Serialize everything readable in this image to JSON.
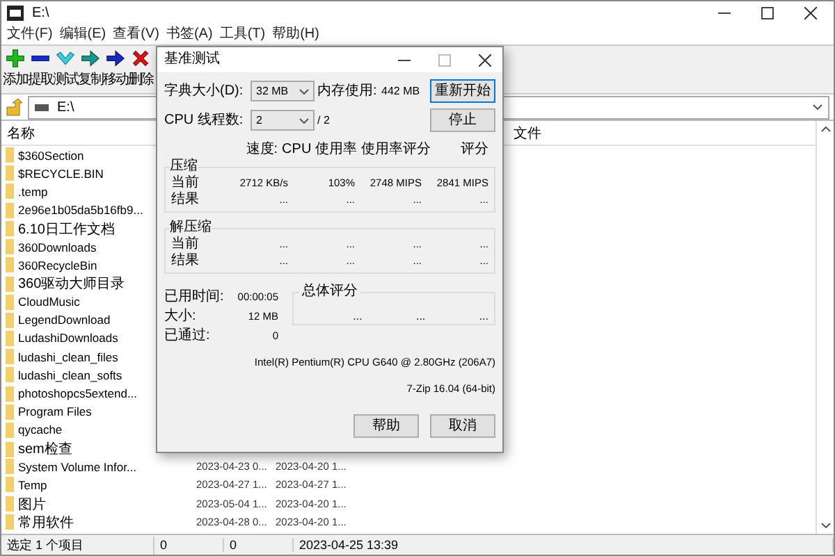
{
  "window": {
    "title": "E:\\"
  },
  "menu": [
    "文件(F)",
    "编辑(E)",
    "查看(V)",
    "书签(A)",
    "工具(T)",
    "帮助(H)"
  ],
  "toolbar": [
    {
      "kind": "add",
      "label": "添加"
    },
    {
      "kind": "extract",
      "label": "提取"
    },
    {
      "kind": "test",
      "label": "测试"
    },
    {
      "kind": "copy",
      "label": "复制"
    },
    {
      "kind": "move",
      "label": "移动"
    },
    {
      "kind": "delete",
      "label": "删除"
    }
  ],
  "address": {
    "value": "E:\\"
  },
  "table": {
    "columns": [
      "名称",
      "文件"
    ],
    "rows": [
      {
        "name": "$360Section"
      },
      {
        "name": "$RECYCLE.BIN"
      },
      {
        "name": ".temp"
      },
      {
        "name": "2e96e1b05da5b16fb9..."
      },
      {
        "name": "6.10日工作文档"
      },
      {
        "name": "360Downloads"
      },
      {
        "name": "360RecycleBin"
      },
      {
        "name": "360驱动大师目录"
      },
      {
        "name": "CloudMusic"
      },
      {
        "name": "LegendDownload"
      },
      {
        "name": "LudashiDownloads"
      },
      {
        "name": "ludashi_clean_files"
      },
      {
        "name": "ludashi_clean_softs"
      },
      {
        "name": "photoshopcs5extend..."
      },
      {
        "name": "Program Files"
      },
      {
        "name": "qycache"
      },
      {
        "name": "sem检查"
      },
      {
        "name": "System Volume Infor...",
        "modified": "2023-04-23 0...",
        "created": "2023-04-20 1..."
      },
      {
        "name": "Temp",
        "modified": "2023-04-27 1...",
        "created": "2023-04-27 1..."
      },
      {
        "name": "图片",
        "modified": "2023-05-04 1...",
        "created": "2023-04-20 1..."
      },
      {
        "name": "常用软件",
        "modified": "2023-04-28 0...",
        "created": "2023-04-20 1..."
      }
    ]
  },
  "status_bar": [
    "选定 1 个项目",
    "0",
    "0",
    "2023-04-25 13:39"
  ],
  "dialog": {
    "title": "基准测试",
    "dict_label": "字典大小(D):",
    "dict_value": "32 MB",
    "mem_label": "内存使用:",
    "mem_value": "442 MB",
    "threads_label": "CPU 线程数:",
    "threads_value": "2",
    "threads_total": "/ 2",
    "buttons_top": [
      "重新开始",
      "停止"
    ],
    "columns": [
      "速度:",
      "CPU 使用率",
      "使用率评分",
      "评分"
    ],
    "groups": [
      {
        "title": "压缩",
        "rows": [
          {
            "label": "当前",
            "values": [
              "2712 KB/s",
              "103%",
              "2748 MIPS",
              "2841 MIPS"
            ]
          },
          {
            "label": "结果",
            "values": [
              "...",
              "...",
              "...",
              "..."
            ]
          }
        ]
      },
      {
        "title": "解压缩",
        "rows": [
          {
            "label": "当前",
            "values": [
              "...",
              "...",
              "...",
              "..."
            ]
          },
          {
            "label": "结果",
            "values": [
              "...",
              "...",
              "...",
              "..."
            ]
          }
        ]
      }
    ],
    "stats": [
      {
        "label": "已用时间:",
        "value": "00:00:05"
      },
      {
        "label": "大小:",
        "value": "12 MB"
      },
      {
        "label": "已通过:",
        "value": "0"
      }
    ],
    "total": {
      "title": "总体评分",
      "values": [
        "...",
        "...",
        "..."
      ]
    },
    "cpu": "Intel(R) Pentium(R) CPU G640 @ 2.80GHz (206A7)",
    "version": "7-Zip 16.04 (64-bit)",
    "buttons_bottom": [
      "帮助",
      "取消"
    ]
  }
}
